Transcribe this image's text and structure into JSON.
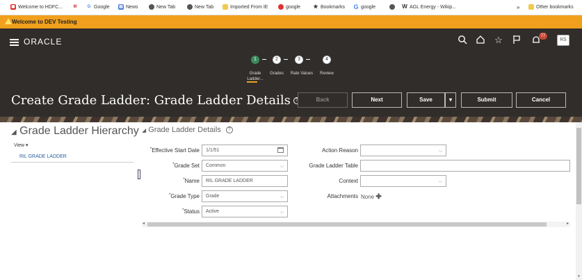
{
  "bookmarks": [
    {
      "label": "Welcome to HDFC...",
      "icon": "hdfc-icon"
    },
    {
      "label": "",
      "icon": "gmail-icon"
    },
    {
      "label": "Google",
      "icon": "google-icon"
    },
    {
      "label": "News",
      "icon": "news-icon"
    },
    {
      "label": "New Tab",
      "icon": "chrome-icon"
    },
    {
      "label": "New Tab",
      "icon": "chrome-icon"
    },
    {
      "label": "Imported From IE",
      "icon": "folder-icon"
    },
    {
      "label": "google",
      "icon": "google-color-icon"
    },
    {
      "label": "Bookmarks",
      "icon": "star-icon"
    },
    {
      "label": "google",
      "icon": "google-icon"
    },
    {
      "label": "",
      "icon": "chrome-icon"
    },
    {
      "label": "AGL Energy - Wikip...",
      "icon": "wikipedia-icon"
    }
  ],
  "bookmarks_overflow": "»",
  "bookmarks_other": "Other bookmarks",
  "banner": {
    "text": "Welcome to DEV Testing"
  },
  "header": {
    "logo": "ORACLE",
    "notification_count": "77",
    "user_initials": "RS"
  },
  "train": {
    "steps": [
      {
        "num": "1",
        "label": "Grade Ladder..."
      },
      {
        "num": "2",
        "label": "Grades"
      },
      {
        "num": "3",
        "label": "Rate Values"
      },
      {
        "num": "4",
        "label": "Review"
      }
    ],
    "current_step": 1
  },
  "page": {
    "title": "Create Grade Ladder: Grade Ladder Details",
    "help": "?",
    "buttons": {
      "back": "Back",
      "next": "Next",
      "save": "Save",
      "submit": "Submit",
      "cancel": "Cancel"
    }
  },
  "sidebar": {
    "title": "Grade Ladder Hierarchy",
    "view_label": "View ▾",
    "items": [
      {
        "label": "RIL GRADE LADDER"
      }
    ]
  },
  "section": {
    "title": "Grade Ladder Details"
  },
  "form": {
    "effective_start_date": {
      "label": "Effective Start Date",
      "value": "1/1/51"
    },
    "grade_set": {
      "label": "Grade Set",
      "value": "Common"
    },
    "name": {
      "label": "Name",
      "value": "RIL GRADE LADDER"
    },
    "grade_type": {
      "label": "Grade Type",
      "value": "Grade"
    },
    "status": {
      "label": "Status",
      "value": "Active"
    },
    "action_reason": {
      "label": "Action Reason",
      "value": ""
    },
    "grade_ladder_table": {
      "label": "Grade Ladder Table",
      "value": ""
    },
    "context": {
      "label": "Context",
      "value": ""
    },
    "attachments": {
      "label": "Attachments",
      "value": "None"
    }
  },
  "colors": {
    "header_bg": "#312d2a",
    "banner_bg": "#f0a01c",
    "active_step": "#3a8a5a"
  }
}
